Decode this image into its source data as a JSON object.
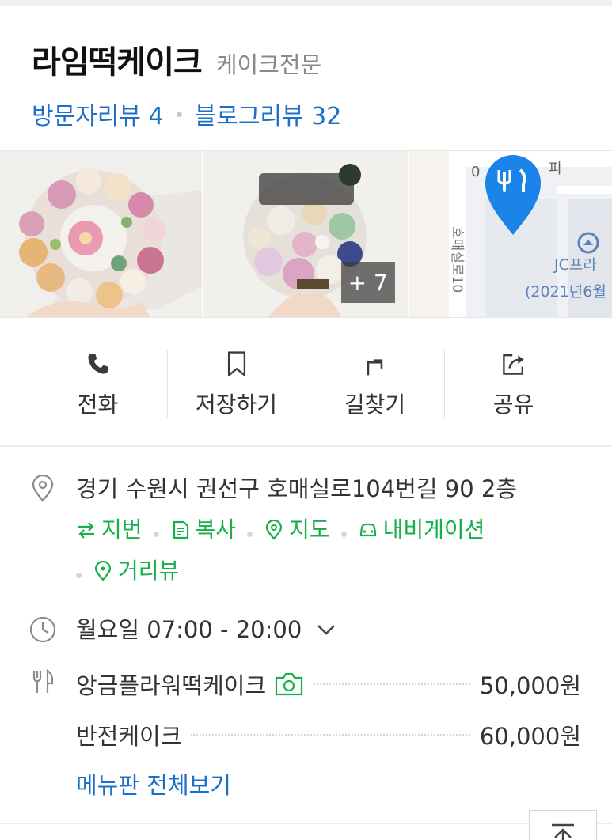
{
  "place": {
    "name": "라임떡케이크",
    "category": "케이크전문",
    "visitor_reviews": "방문자리뷰 4",
    "blog_reviews": "블로그리뷰 32"
  },
  "photos": {
    "more_count": "+ 7",
    "map_labels": [
      "피",
      "호매실로10",
      "JC프라",
      "(2021년6월"
    ]
  },
  "actions": [
    {
      "label": "전화",
      "icon": "phone-icon"
    },
    {
      "label": "저장하기",
      "icon": "bookmark-icon"
    },
    {
      "label": "길찾기",
      "icon": "directions-icon"
    },
    {
      "label": "공유",
      "icon": "share-icon"
    }
  ],
  "address": {
    "text": "경기 수원시 권선구 호매실로104번길 90 2층",
    "links": [
      {
        "label": "지번",
        "icon": "swap-arrows-icon"
      },
      {
        "label": "복사",
        "icon": "copy-icon"
      },
      {
        "label": "지도",
        "icon": "map-pin-icon"
      },
      {
        "label": "내비게이션",
        "icon": "car-icon"
      },
      {
        "label": "거리뷰",
        "icon": "street-view-icon"
      }
    ]
  },
  "hours": {
    "text": "월요일 07:00 - 20:00"
  },
  "menu": {
    "items": [
      {
        "name": "앙금플라워떡케이크",
        "price": "50,000원",
        "has_photo": true
      },
      {
        "name": "반전케이크",
        "price": "60,000원",
        "has_photo": false
      }
    ],
    "view_all": "메뉴판 전체보기"
  },
  "colors": {
    "link_blue": "#1d6fc9",
    "link_green": "#17b04a",
    "map_pin": "#1a84e8"
  }
}
